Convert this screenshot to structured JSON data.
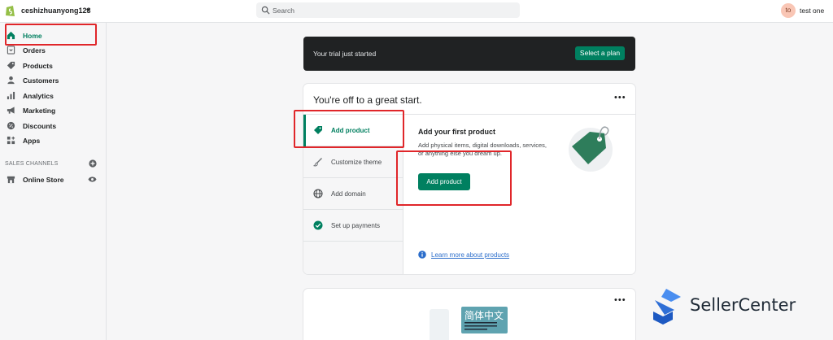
{
  "topbar": {
    "store_name": "ceshizhuanyong123",
    "caret": "▾",
    "search_placeholder": "Search",
    "avatar_initials": "to",
    "user_name": "test one"
  },
  "sidebar": {
    "items": [
      {
        "label": "Home"
      },
      {
        "label": "Orders"
      },
      {
        "label": "Products"
      },
      {
        "label": "Customers"
      },
      {
        "label": "Analytics"
      },
      {
        "label": "Marketing"
      },
      {
        "label": "Discounts"
      },
      {
        "label": "Apps"
      }
    ],
    "channels_label": "SALES CHANNELS",
    "online_store": "Online Store"
  },
  "trial": {
    "text": "Your trial just started",
    "button": "Select a plan"
  },
  "setup_card": {
    "title": "You're off to a great start.",
    "menu": "•••",
    "steps": [
      {
        "label": "Add product"
      },
      {
        "label": "Customize theme"
      },
      {
        "label": "Add domain"
      },
      {
        "label": "Set up payments"
      }
    ],
    "detail_title": "Add your first product",
    "detail_desc": "Add physical items, digital downloads, services, or anything else you dream up.",
    "detail_button": "Add product",
    "learn_link": "Learn more about products"
  },
  "second_card": {
    "menu": "•••",
    "lang_text": "简体中文"
  },
  "watermark": {
    "text": "SellerCenter"
  },
  "colors": {
    "accent": "#008060",
    "highlight_red": "#e0262a",
    "link": "#2c6ecb"
  }
}
